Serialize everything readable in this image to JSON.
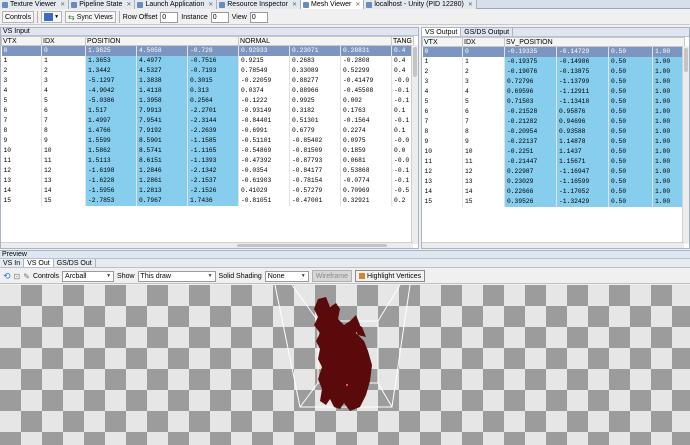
{
  "tabs": [
    {
      "label": "Texture Viewer",
      "active": false
    },
    {
      "label": "Pipeline State",
      "active": false
    },
    {
      "label": "Launch Application",
      "active": false
    },
    {
      "label": "Resource Inspector",
      "active": false
    },
    {
      "label": "Mesh Viewer",
      "active": true
    },
    {
      "label": "localhost - Unity (PID 12280)",
      "active": false
    }
  ],
  "toolbar": {
    "controls_label": "Controls",
    "sync_views_label": "Sync Views",
    "row_offset_label": "Row Offset",
    "row_offset_value": "0",
    "instance_label": "Instance",
    "instance_value": "0",
    "view_label": "View",
    "view_value": "0"
  },
  "vs_input": {
    "title": "VS Input",
    "columns": [
      "VTX",
      "IDX",
      "POSITION",
      "NORMAL",
      "TANG"
    ],
    "rows": [
      {
        "vtx": "0",
        "idx": "0",
        "pos": [
          "1.3625",
          "4.5058",
          "-0.728"
        ],
        "nrm": [
          "0.92933",
          "0.23071",
          "0.28831"
        ],
        "tan": "0.4"
      },
      {
        "vtx": "1",
        "idx": "1",
        "pos": [
          "1.3653",
          "4.4977",
          "-0.7516"
        ],
        "nrm": [
          "0.9215",
          "0.2683",
          "-0.2808"
        ],
        "tan": "0.4"
      },
      {
        "vtx": "2",
        "idx": "2",
        "pos": [
          "1.3442",
          "4.5327",
          "-0.7193"
        ],
        "nrm": [
          "0.78549",
          "0.33089",
          "0.52299"
        ],
        "tan": "0.4"
      },
      {
        "vtx": "3",
        "idx": "3",
        "pos": [
          "-5.1297",
          "1.3838",
          "0.3015"
        ],
        "nrm": [
          "-0.22059",
          "0.88277",
          "-0.41479"
        ],
        "tan": "-0.0"
      },
      {
        "vtx": "4",
        "idx": "4",
        "pos": [
          "-4.9042",
          "1.4118",
          "0.313"
        ],
        "nrm": [
          "0.0374",
          "0.88966",
          "-0.45508"
        ],
        "tan": "-0.1"
      },
      {
        "vtx": "5",
        "idx": "5",
        "pos": [
          "-5.0386",
          "1.3958",
          "0.2564"
        ],
        "nrm": [
          "-0.1222",
          "0.9925",
          "0.002"
        ],
        "tan": "-0.1"
      },
      {
        "vtx": "6",
        "idx": "6",
        "pos": [
          "1.517",
          "7.9913",
          "-2.2701"
        ],
        "nrm": [
          "-0.93149",
          "0.3182",
          "0.1763"
        ],
        "tan": "0.1"
      },
      {
        "vtx": "7",
        "idx": "7",
        "pos": [
          "1.4997",
          "7.9541",
          "-2.3144"
        ],
        "nrm": [
          "-0.84401",
          "0.51301",
          "-0.1564"
        ],
        "tan": "-0.1"
      },
      {
        "vtx": "8",
        "idx": "8",
        "pos": [
          "1.4766",
          "7.9192",
          "-2.2639"
        ],
        "nrm": [
          "-0.6991",
          "0.6779",
          "0.2274"
        ],
        "tan": "0.1"
      },
      {
        "vtx": "9",
        "idx": "9",
        "pos": [
          "1.5599",
          "8.5901",
          "-1.1585"
        ],
        "nrm": [
          "-0.51101",
          "-0.85402",
          "0.0975"
        ],
        "tan": "-0.0"
      },
      {
        "vtx": "10",
        "idx": "10",
        "pos": [
          "1.5862",
          "8.5741",
          "-1.1165"
        ],
        "nrm": [
          "-0.54869",
          "-0.81509",
          "0.1859"
        ],
        "tan": "0.0"
      },
      {
        "vtx": "11",
        "idx": "11",
        "pos": [
          "1.5113",
          "8.6151",
          "-1.1393"
        ],
        "nrm": [
          "-0.47392",
          "-0.87793",
          "0.0681"
        ],
        "tan": "-0.0"
      },
      {
        "vtx": "12",
        "idx": "12",
        "pos": [
          "-1.6198",
          "1.2846",
          "-2.1342"
        ],
        "nrm": [
          "-0.0354",
          "-0.84177",
          "0.53868"
        ],
        "tan": "-0.1"
      },
      {
        "vtx": "13",
        "idx": "13",
        "pos": [
          "-1.6228",
          "1.2861",
          "-2.1537"
        ],
        "nrm": [
          "-0.61903",
          "-0.78154",
          "-0.0774"
        ],
        "tan": "-0.1"
      },
      {
        "vtx": "14",
        "idx": "14",
        "pos": [
          "-1.5956",
          "1.2813",
          "-2.1526"
        ],
        "nrm": [
          "0.41029",
          "-0.57279",
          "0.70969"
        ],
        "tan": "-0.5"
      },
      {
        "vtx": "15",
        "idx": "15",
        "pos": [
          "-2.7853",
          "0.7967",
          "1.7436"
        ],
        "nrm": [
          "-0.81051",
          "-0.47001",
          "0.32921"
        ],
        "tan": "0.2"
      }
    ]
  },
  "vs_output": {
    "tabs": [
      "VS Output",
      "GS/DS Output"
    ],
    "columns": [
      "VTX",
      "IDX",
      "SV_POSITION"
    ],
    "rows": [
      {
        "vtx": "0",
        "idx": "0",
        "pos": [
          "-0.19335",
          "-0.14729",
          "0.50",
          "1.00"
        ]
      },
      {
        "vtx": "1",
        "idx": "1",
        "pos": [
          "-0.19375",
          "-0.14986",
          "0.50",
          "1.00"
        ]
      },
      {
        "vtx": "2",
        "idx": "2",
        "pos": [
          "-0.19076",
          "-0.13875",
          "0.50",
          "1.00"
        ]
      },
      {
        "vtx": "3",
        "idx": "3",
        "pos": [
          "0.72796",
          "-1.13799",
          "0.50",
          "1.00"
        ]
      },
      {
        "vtx": "4",
        "idx": "4",
        "pos": [
          "0.69596",
          "-1.12911",
          "0.50",
          "1.00"
        ]
      },
      {
        "vtx": "5",
        "idx": "5",
        "pos": [
          "0.71503",
          "-1.13418",
          "0.50",
          "1.00"
        ]
      },
      {
        "vtx": "6",
        "idx": "6",
        "pos": [
          "-0.21528",
          "0.95876",
          "0.50",
          "1.00"
        ]
      },
      {
        "vtx": "7",
        "idx": "7",
        "pos": [
          "-0.21282",
          "0.94696",
          "0.50",
          "1.00"
        ]
      },
      {
        "vtx": "8",
        "idx": "8",
        "pos": [
          "-0.20954",
          "0.93588",
          "0.50",
          "1.00"
        ]
      },
      {
        "vtx": "9",
        "idx": "9",
        "pos": [
          "-0.22137",
          "1.14878",
          "0.50",
          "1.00"
        ]
      },
      {
        "vtx": "10",
        "idx": "10",
        "pos": [
          "-0.2251",
          "1.1437",
          "0.50",
          "1.00"
        ]
      },
      {
        "vtx": "11",
        "idx": "11",
        "pos": [
          "-0.21447",
          "1.15671",
          "0.50",
          "1.00"
        ]
      },
      {
        "vtx": "12",
        "idx": "12",
        "pos": [
          "0.22987",
          "-1.16947",
          "0.50",
          "1.00"
        ]
      },
      {
        "vtx": "13",
        "idx": "13",
        "pos": [
          "0.23029",
          "-1.16599",
          "0.50",
          "1.00"
        ]
      },
      {
        "vtx": "14",
        "idx": "14",
        "pos": [
          "0.22666",
          "-1.17052",
          "0.50",
          "1.00"
        ]
      },
      {
        "vtx": "15",
        "idx": "15",
        "pos": [
          "0.39526",
          "-1.32429",
          "0.50",
          "1.00"
        ]
      }
    ]
  },
  "preview": {
    "title": "Preview",
    "tabs": [
      "VS In",
      "VS Out",
      "GS/DS Out"
    ],
    "active_tab": 1,
    "controls_label": "Controls",
    "controls_value": "Arcball",
    "show_label": "Show",
    "show_value": "This draw",
    "solid_shading_label": "Solid Shading",
    "solid_shading_value": "None",
    "wireframe_label": "Wireframe",
    "highlight_label": "Highlight Vertices"
  },
  "colors": {
    "position_cell": "#86cdee",
    "selected_row": "#7c95c1",
    "mesh_fill": "#5a0a0a",
    "frustum": "#ffffff"
  }
}
